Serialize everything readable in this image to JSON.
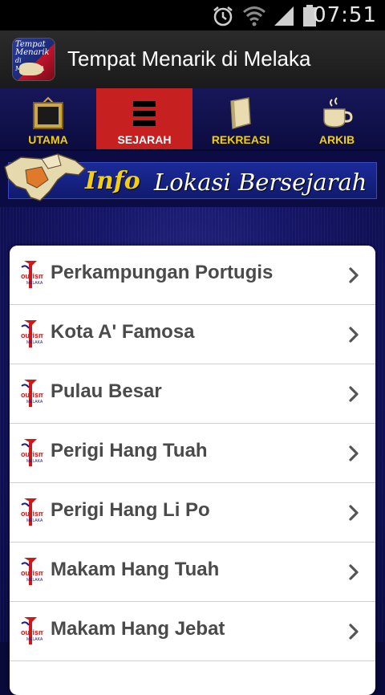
{
  "status_bar": {
    "time": "07:51",
    "icons": [
      "alarm-icon",
      "wifi-icon",
      "signal-icon",
      "battery-icon"
    ]
  },
  "title_bar": {
    "app_icon_lines": [
      "Tempat",
      "Menarik",
      "di MELAKA"
    ],
    "title": "Tempat Menarik di Melaka"
  },
  "tabs": [
    {
      "label": "UTAMA",
      "icon": "tv-icon",
      "active": false
    },
    {
      "label": "SEJARAH",
      "icon": "list-icon",
      "active": true
    },
    {
      "label": "REKREASI",
      "icon": "book-icon",
      "active": false
    },
    {
      "label": "ARKIB",
      "icon": "coffee-cup-icon",
      "active": false
    }
  ],
  "banner": {
    "highlight": "Info",
    "rest": "Lokasi Bersejarah"
  },
  "list": {
    "items": [
      {
        "label": "Perkampungan Portugis"
      },
      {
        "label": "Kota A' Famosa"
      },
      {
        "label": "Pulau Besar"
      },
      {
        "label": "Perigi Hang Tuah"
      },
      {
        "label": "Perigi Hang Li Po"
      },
      {
        "label": "Makam Hang Tuah"
      },
      {
        "label": "Makam Hang Jebat"
      }
    ],
    "item_logo_text": [
      "ourism",
      "MELAKA"
    ]
  },
  "colors": {
    "tab_text": "#f1d000",
    "tab_active_bg": "#c62020",
    "banner_highlight": "#f2cf10",
    "list_text": "#4a4a4a"
  }
}
